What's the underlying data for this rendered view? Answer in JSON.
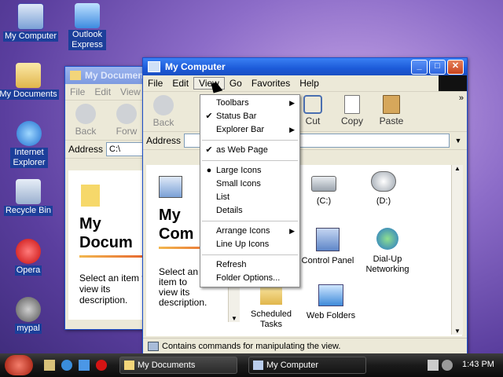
{
  "desktop": {
    "icons": [
      {
        "label": "My Computer"
      },
      {
        "label": "Outlook Express"
      },
      {
        "label": "My Documents"
      },
      {
        "label": "Internet Explorer"
      },
      {
        "label": "Recycle Bin"
      },
      {
        "label": "Opera"
      },
      {
        "label": "mypal"
      }
    ]
  },
  "back_window": {
    "title": "My Documen",
    "menu": [
      "File",
      "Edit",
      "View"
    ],
    "toolbar": {
      "back": "Back",
      "forward": "Forw"
    },
    "address_label": "Address",
    "address_value": "C:\\",
    "panel_title": "My Documents",
    "panel_title_line1": "My",
    "panel_title_line2": "Docum",
    "panel_text": "Select an item to view its description."
  },
  "main_window": {
    "title": "My Computer",
    "menu": [
      "File",
      "Edit",
      "View",
      "Go",
      "Favorites",
      "Help"
    ],
    "toolbar": {
      "back": "Back",
      "cut": "Cut",
      "copy": "Copy",
      "paste": "Paste"
    },
    "address_label": "Address",
    "panel_title_line1": "My",
    "panel_title_line2": "Com",
    "panel_text": "Select an item to view its description.",
    "items": [
      {
        "label": "(C:)"
      },
      {
        "label": "(D:)"
      },
      {
        "label": "Control Panel"
      },
      {
        "label": "Dial-Up Networking"
      },
      {
        "label": "Scheduled Tasks"
      },
      {
        "label": "Web Folders"
      }
    ],
    "status": "Contains commands for manipulating the view."
  },
  "view_menu": {
    "items": [
      {
        "label": "Toolbars",
        "mark": "",
        "arrow": true
      },
      {
        "label": "Status Bar",
        "mark": "✔",
        "arrow": false
      },
      {
        "label": "Explorer Bar",
        "mark": "",
        "arrow": true
      },
      {
        "sep": true
      },
      {
        "label": "as Web Page",
        "mark": "✔",
        "arrow": false
      },
      {
        "sep": true
      },
      {
        "label": "Large Icons",
        "mark": "●",
        "arrow": false
      },
      {
        "label": "Small Icons",
        "mark": "",
        "arrow": false
      },
      {
        "label": "List",
        "mark": "",
        "arrow": false
      },
      {
        "label": "Details",
        "mark": "",
        "arrow": false
      },
      {
        "sep": true
      },
      {
        "label": "Arrange Icons",
        "mark": "",
        "arrow": true
      },
      {
        "label": "Line Up Icons",
        "mark": "",
        "arrow": false
      },
      {
        "sep": true
      },
      {
        "label": "Refresh",
        "mark": "",
        "arrow": false
      },
      {
        "label": "Folder Options...",
        "mark": "",
        "arrow": false
      }
    ]
  },
  "taskbar": {
    "tasks": [
      {
        "label": "My Documents"
      },
      {
        "label": "My Computer"
      }
    ],
    "clock": "1:43 PM"
  }
}
